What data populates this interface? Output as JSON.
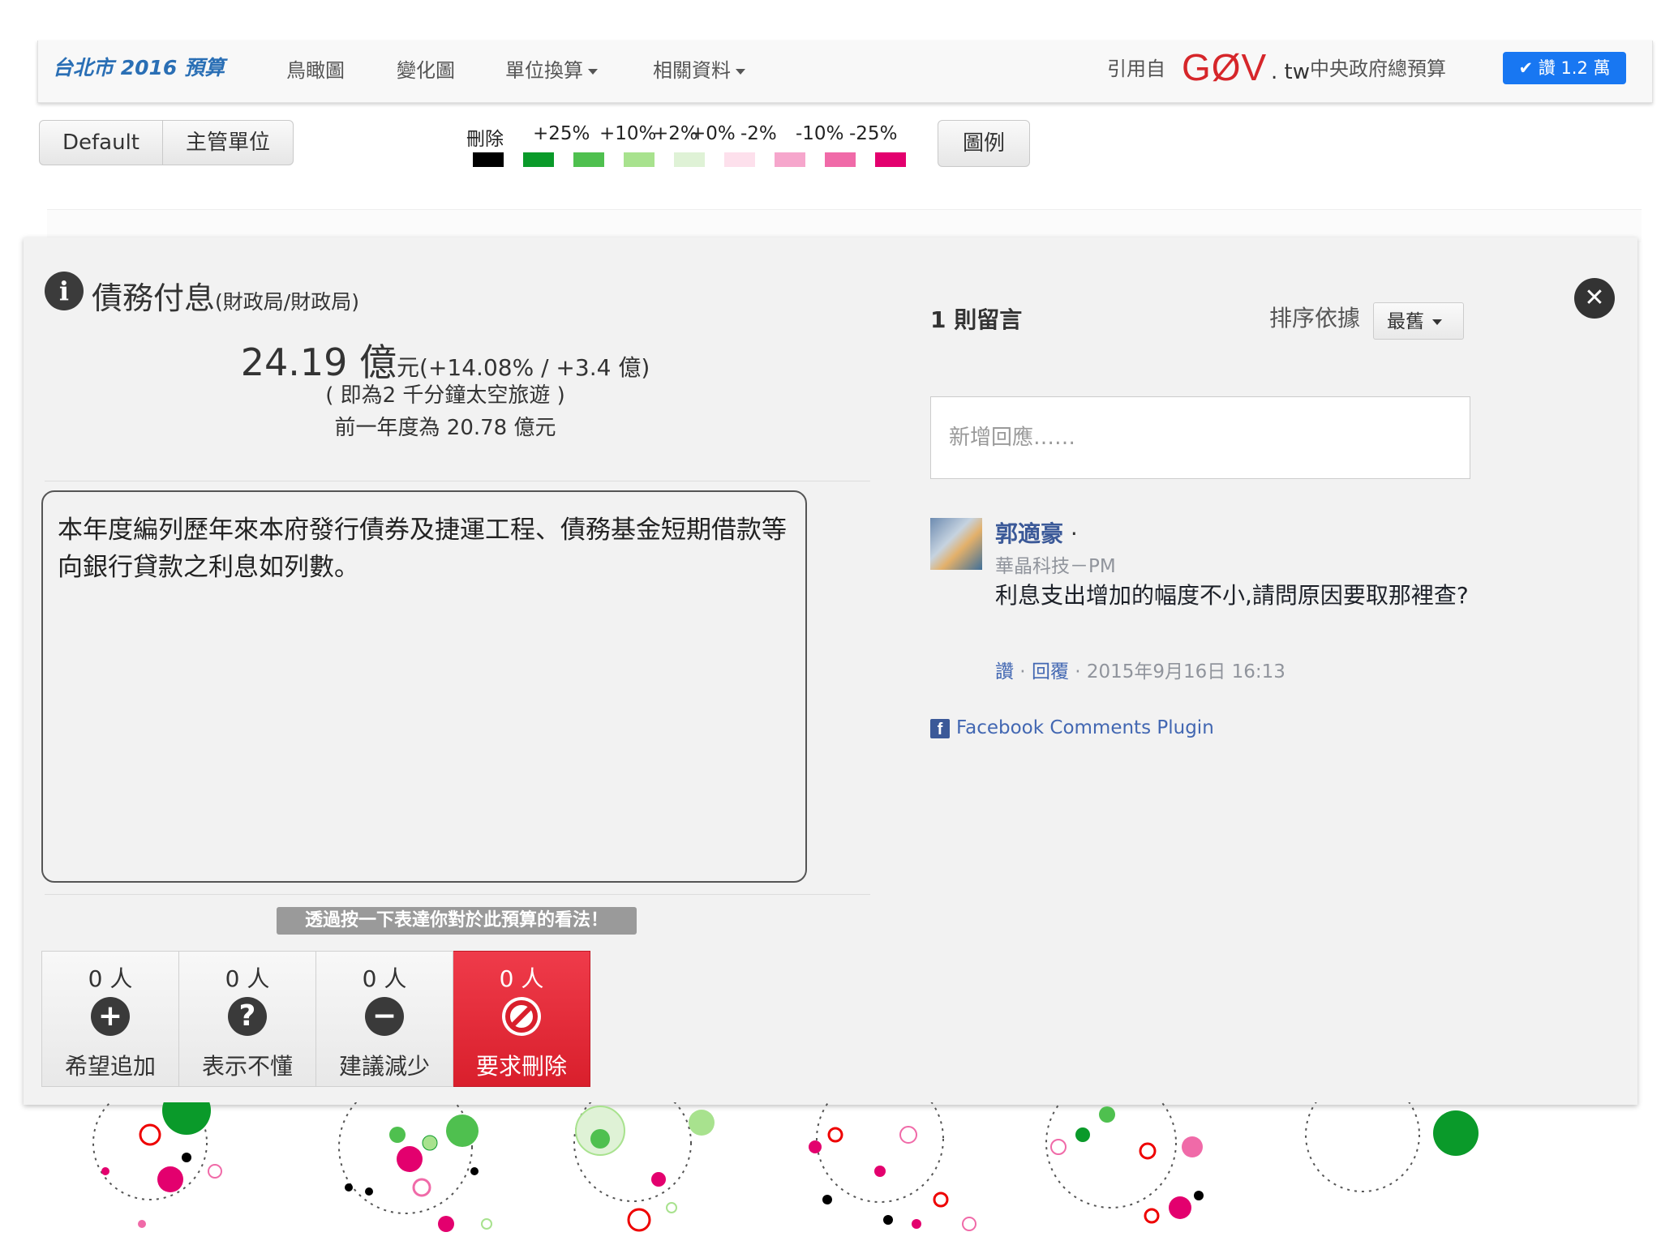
{
  "navbar": {
    "brand": "台北市 2016 預算",
    "items": [
      "鳥瞰圖",
      "變化圖",
      "單位換算",
      "相關資料"
    ],
    "cite_label": "引用自",
    "gov_logo": "GØV",
    "gov_tw": ". tw",
    "gov_budget": "中央政府總預算",
    "like_label": "讚 1.2 萬"
  },
  "toolbar": {
    "buttons": [
      "Default",
      "主管單位"
    ],
    "legend_button": "圖例",
    "legend": {
      "labels": [
        "刪除",
        "+25%",
        "+10%",
        "+2%",
        "+0%",
        "-2%",
        "-10%",
        "-25%"
      ],
      "colors": [
        "#000000",
        "#0a9a2a",
        "#4fc04f",
        "#a8e28e",
        "#dff2d6",
        "#fde0ec",
        "#f6a6cc",
        "#f06aa8",
        "#e3006e"
      ]
    }
  },
  "item": {
    "title": "債務付息",
    "agency": "(財政局/財政局)",
    "amount": "24.19 億",
    "amount_unit": "元(+14.08% / +3.4 億)",
    "equivalent": "( 即為2 千分鐘太空旅遊 )",
    "prev_year": "前一年度為 20.78 億元",
    "description": "本年度編列歷年來本府發行債券及捷運工程、債務基金短期借款等向銀行貸款之利息如列數。"
  },
  "votes": {
    "hint": "透過按一下表達你對於此預算的看法！",
    "options": [
      {
        "count": "0 人",
        "icon": "plus-icon",
        "label": "希望追加"
      },
      {
        "count": "0 人",
        "icon": "question-icon",
        "label": "表示不懂"
      },
      {
        "count": "0 人",
        "icon": "minus-icon",
        "label": "建議減少"
      },
      {
        "count": "0 人",
        "icon": "ban-icon",
        "label": "要求刪除"
      }
    ]
  },
  "comments": {
    "count": "1 則留言",
    "sort_label": "排序依據",
    "sort_value": "最舊",
    "input_placeholder": "新增回應……",
    "author": "郭適豪",
    "author_job": "華晶科技－PM",
    "body": "利息支出增加的幅度不小,請問原因要取那裡查?",
    "meta_like": "讚",
    "meta_reply": "回覆",
    "meta_time": "2015年9月16日 16:13",
    "plugin_label": "Facebook Comments Plugin"
  },
  "colors": {
    "accent": "#2a6fb5",
    "gov_red": "#d6262a",
    "fb_blue": "#1877f2",
    "danger": "#e5202e"
  }
}
